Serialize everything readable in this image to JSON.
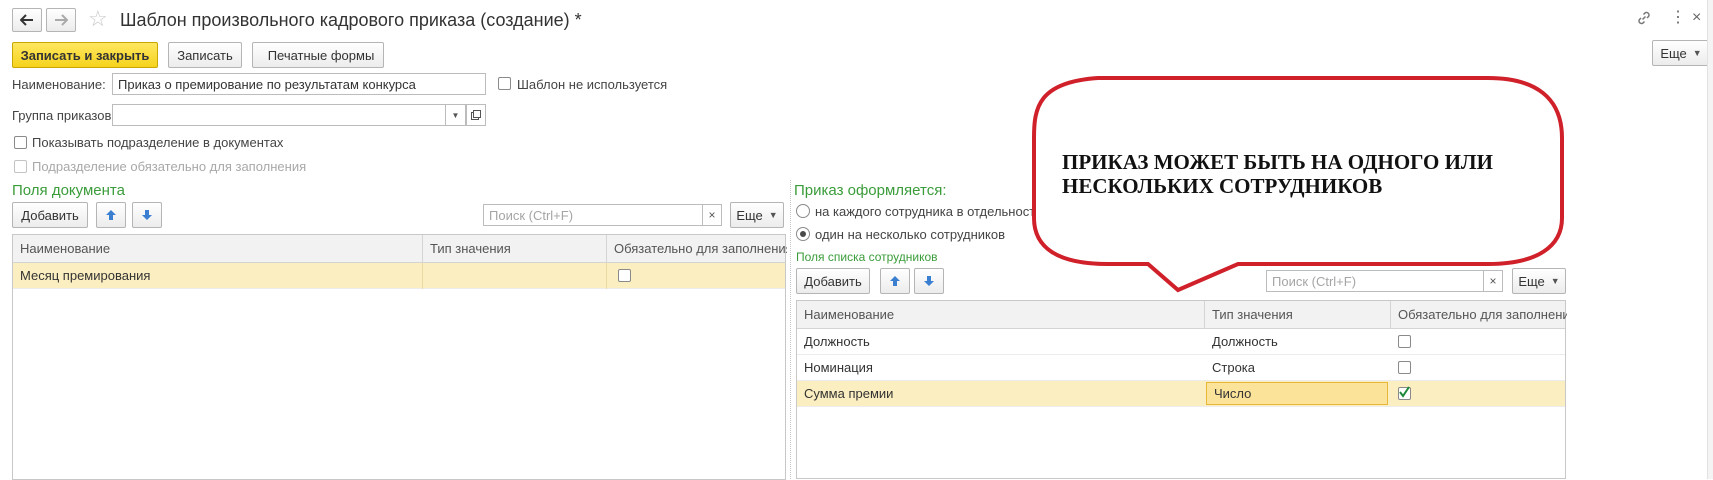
{
  "window": {
    "title": "Шаблон произвольного кадрового приказа (создание) *"
  },
  "toolbar": {
    "save_close": "Записать и закрыть",
    "save": "Записать",
    "print_forms": "Печатные формы",
    "more": "Еще"
  },
  "form": {
    "name_label": "Наименование:",
    "name_value": "Приказ о премирование по результатам конкурса",
    "unused_label": "Шаблон не используется",
    "group_label": "Группа приказов:",
    "group_value": "",
    "show_division_label": "Показывать подразделение в документах",
    "division_required_label": "Подразделение обязательно для заполнения"
  },
  "doc_fields": {
    "title": "Поля документа",
    "add": "Добавить",
    "search_placeholder": "Поиск (Ctrl+F)",
    "more": "Еще",
    "columns": [
      "Наименование",
      "Тип значения",
      "Обязательно для заполнения"
    ],
    "rows": [
      {
        "name": "Месяц премирования",
        "type": "",
        "required": false
      }
    ]
  },
  "order_mode": {
    "title": "Приказ оформляется:",
    "option1": "на каждого сотрудника в отдельности",
    "option2": "один на несколько сотрудников",
    "selected": 2
  },
  "emp_fields": {
    "title": "Поля списка сотрудников",
    "add": "Добавить",
    "search_placeholder": "Поиск (Ctrl+F)",
    "more": "Еще",
    "columns": [
      "Наименование",
      "Тип значения",
      "Обязательно для заполнения"
    ],
    "rows": [
      {
        "name": "Должность",
        "type": "Должность",
        "required": false
      },
      {
        "name": "Номинация",
        "type": "Строка",
        "required": false
      },
      {
        "name": "Сумма премии",
        "type": "Число",
        "required": true
      }
    ]
  },
  "callout": {
    "text_line1": "ПРИКАЗ МОЖЕТ БЫТЬ НА ОДНОГО ИЛИ",
    "text_line2": "НЕСКОЛЬКИХ СОТРУДНИКОВ",
    "color": "#d0202a"
  }
}
